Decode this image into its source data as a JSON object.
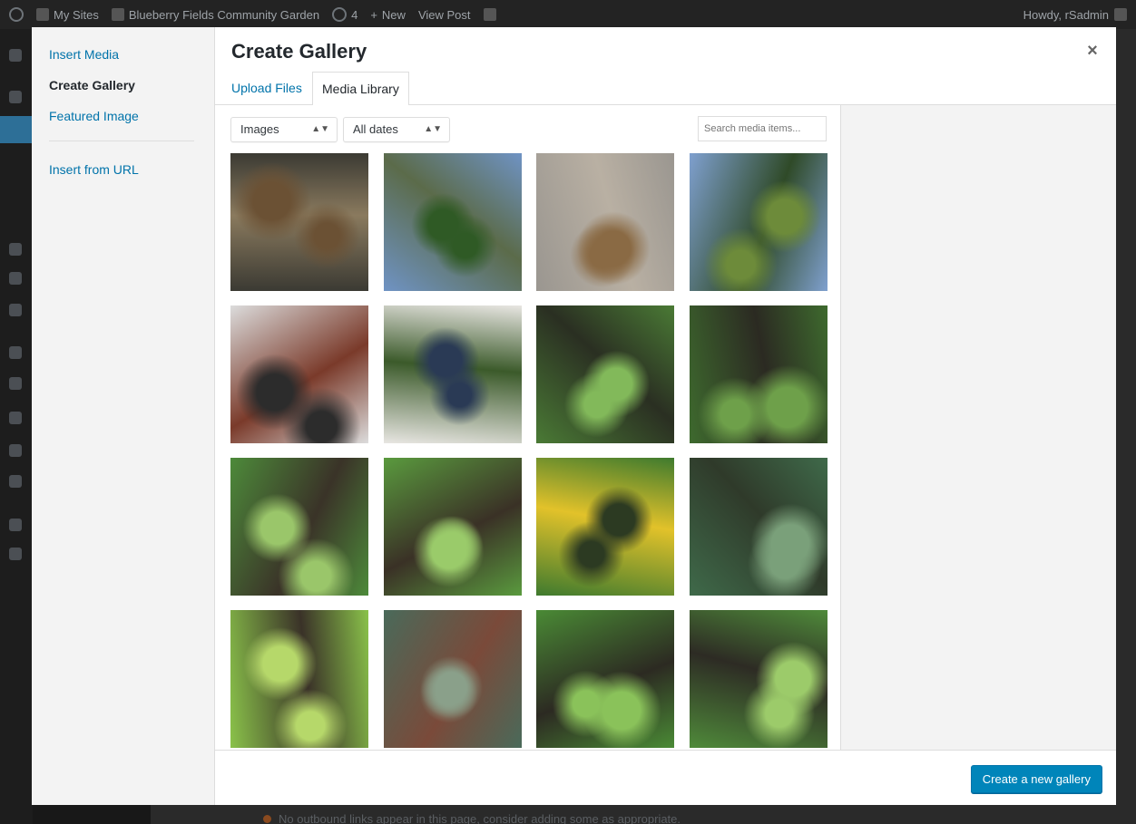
{
  "admin_bar": {
    "items": [
      {
        "label": "My Sites",
        "icon": "my-sites-icon"
      },
      {
        "label": "Blueberry Fields Community Garden",
        "icon": "home-icon"
      },
      {
        "label": "4",
        "icon": "updates-icon"
      },
      {
        "label": "New",
        "icon": "plus-icon"
      },
      {
        "label": "View Post",
        "icon": ""
      }
    ],
    "greeting": "Howdy, rSadmin"
  },
  "background_notice": "No outbound links appear in this page, consider adding some as appropriate.",
  "modal": {
    "title": "Create Gallery",
    "close_icon": "×",
    "menu": {
      "items": [
        {
          "label": "Insert Media",
          "active": false
        },
        {
          "label": "Create Gallery",
          "active": true
        },
        {
          "label": "Featured Image",
          "active": false
        }
      ],
      "after_separator": [
        {
          "label": "Insert from URL",
          "active": false
        }
      ]
    },
    "tabs": [
      {
        "label": "Upload Files",
        "active": false
      },
      {
        "label": "Media Library",
        "active": true
      }
    ],
    "filters": {
      "type": "Images",
      "date": "All dates",
      "search_placeholder": "Search media items..."
    },
    "footer": {
      "primary_button": "Create a new gallery"
    },
    "media_items": [
      {
        "subject": "raised bed with basket of potatoes",
        "colors": [
          "#3b3a33",
          "#8a7a5e",
          "#6b5134"
        ]
      },
      {
        "subject": "garden beds under blue sky",
        "colors": [
          "#6f93c4",
          "#5b6b4a",
          "#2f5a25"
        ]
      },
      {
        "subject": "box of potatoes on pavement",
        "colors": [
          "#9a9690",
          "#b9b0a3",
          "#8a6a44"
        ]
      },
      {
        "subject": "treeline and field",
        "colors": [
          "#7fa0cf",
          "#2f4a28",
          "#6d8b3a"
        ]
      },
      {
        "subject": "people beside garden sign",
        "colors": [
          "#dcdcdc",
          "#7a3a2a",
          "#2c2c2c"
        ]
      },
      {
        "subject": "group under Blueberry Fields arch",
        "colors": [
          "#e8e6e2",
          "#3b5a2a",
          "#2a3a55"
        ]
      },
      {
        "subject": "young lettuce seedlings",
        "colors": [
          "#4a7a35",
          "#2a2f22",
          "#82b95a"
        ]
      },
      {
        "subject": "tomato seedlings in soil",
        "colors": [
          "#3e6a2e",
          "#2b2a22",
          "#6ea04a"
        ]
      },
      {
        "subject": "zucchini stems close-up",
        "colors": [
          "#4d8a3a",
          "#3a3328",
          "#9ac66a"
        ]
      },
      {
        "subject": "lettuce rows",
        "colors": [
          "#5a9a3e",
          "#3a3126",
          "#9acb6a"
        ]
      },
      {
        "subject": "squash blossom",
        "colors": [
          "#3f7a2e",
          "#e2c22a",
          "#2c3a22"
        ]
      },
      {
        "subject": "kale rows",
        "colors": [
          "#3f6a4a",
          "#2f3a2a",
          "#7aa07a"
        ]
      },
      {
        "subject": "leaf lettuce clumps",
        "colors": [
          "#8ac24a",
          "#3a3228",
          "#b6d86a"
        ]
      },
      {
        "subject": "onion greens",
        "colors": [
          "#4a6a5a",
          "#7a4a3a",
          "#8aa08a"
        ]
      },
      {
        "subject": "pepper plant",
        "colors": [
          "#4a8a35",
          "#2c2a22",
          "#8ac25a"
        ]
      },
      {
        "subject": "pepper seedling",
        "colors": [
          "#4f8a3a",
          "#2d2b24",
          "#9ccb6a"
        ]
      }
    ]
  }
}
